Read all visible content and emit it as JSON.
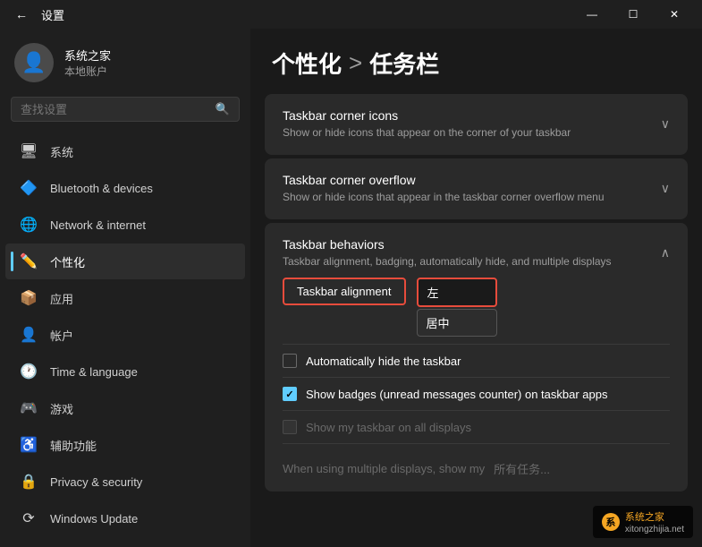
{
  "titleBar": {
    "appTitle": "设置",
    "minLabel": "—",
    "maxLabel": "☐",
    "closeLabel": "✕",
    "backLabel": "←"
  },
  "sidebar": {
    "searchPlaceholder": "查找设置",
    "user": {
      "name": "系统之家",
      "subtitle": "本地账户"
    },
    "navItems": [
      {
        "id": "system",
        "label": "系统",
        "icon": "🖥"
      },
      {
        "id": "bluetooth",
        "label": "Bluetooth & devices",
        "icon": "🔷"
      },
      {
        "id": "network",
        "label": "Network & internet",
        "icon": "🌐"
      },
      {
        "id": "personalization",
        "label": "个性化",
        "icon": "✏️",
        "active": true
      },
      {
        "id": "apps",
        "label": "应用",
        "icon": "📦"
      },
      {
        "id": "accounts",
        "label": "帐户",
        "icon": "👤"
      },
      {
        "id": "time",
        "label": "Time & language",
        "icon": "🕐"
      },
      {
        "id": "gaming",
        "label": "游戏",
        "icon": "🎮"
      },
      {
        "id": "accessibility",
        "label": "辅助功能",
        "icon": "♿"
      },
      {
        "id": "privacy",
        "label": "Privacy & security",
        "icon": "🔒"
      },
      {
        "id": "update",
        "label": "Windows Update",
        "icon": "⟳"
      }
    ]
  },
  "content": {
    "breadcrumb1": "个性化",
    "breadcrumbSep": ">",
    "breadcrumb2": "任务栏",
    "cards": [
      {
        "id": "corner-icons",
        "title": "Taskbar corner icons",
        "desc": "Show or hide icons that appear on the corner of your taskbar",
        "expanded": false,
        "chevron": "∨"
      },
      {
        "id": "corner-overflow",
        "title": "Taskbar corner overflow",
        "desc": "Show or hide icons that appear in the taskbar corner overflow menu",
        "expanded": false,
        "chevron": "∨"
      }
    ],
    "behaviorsCard": {
      "title": "Taskbar behaviors",
      "desc": "Taskbar alignment, badging, automatically hide, and multiple displays",
      "chevron": "∧",
      "alignmentLabel": "Taskbar alignment",
      "currentOption": "左",
      "nextOption": "居中",
      "checkboxes": [
        {
          "id": "auto-hide",
          "label": "Automatically hide the taskbar",
          "checked": false,
          "disabled": false
        },
        {
          "id": "badges",
          "label": "Show badges (unread messages counter) on taskbar apps",
          "checked": true,
          "disabled": false
        },
        {
          "id": "all-displays",
          "label": "Show my taskbar on all displays",
          "checked": false,
          "disabled": true
        }
      ],
      "bottomLabel": "When using multiple displays, show my",
      "bottomValue": "所有任务..."
    }
  },
  "watermark": {
    "text": "系统之家",
    "site": "xitongzhijia.net"
  }
}
